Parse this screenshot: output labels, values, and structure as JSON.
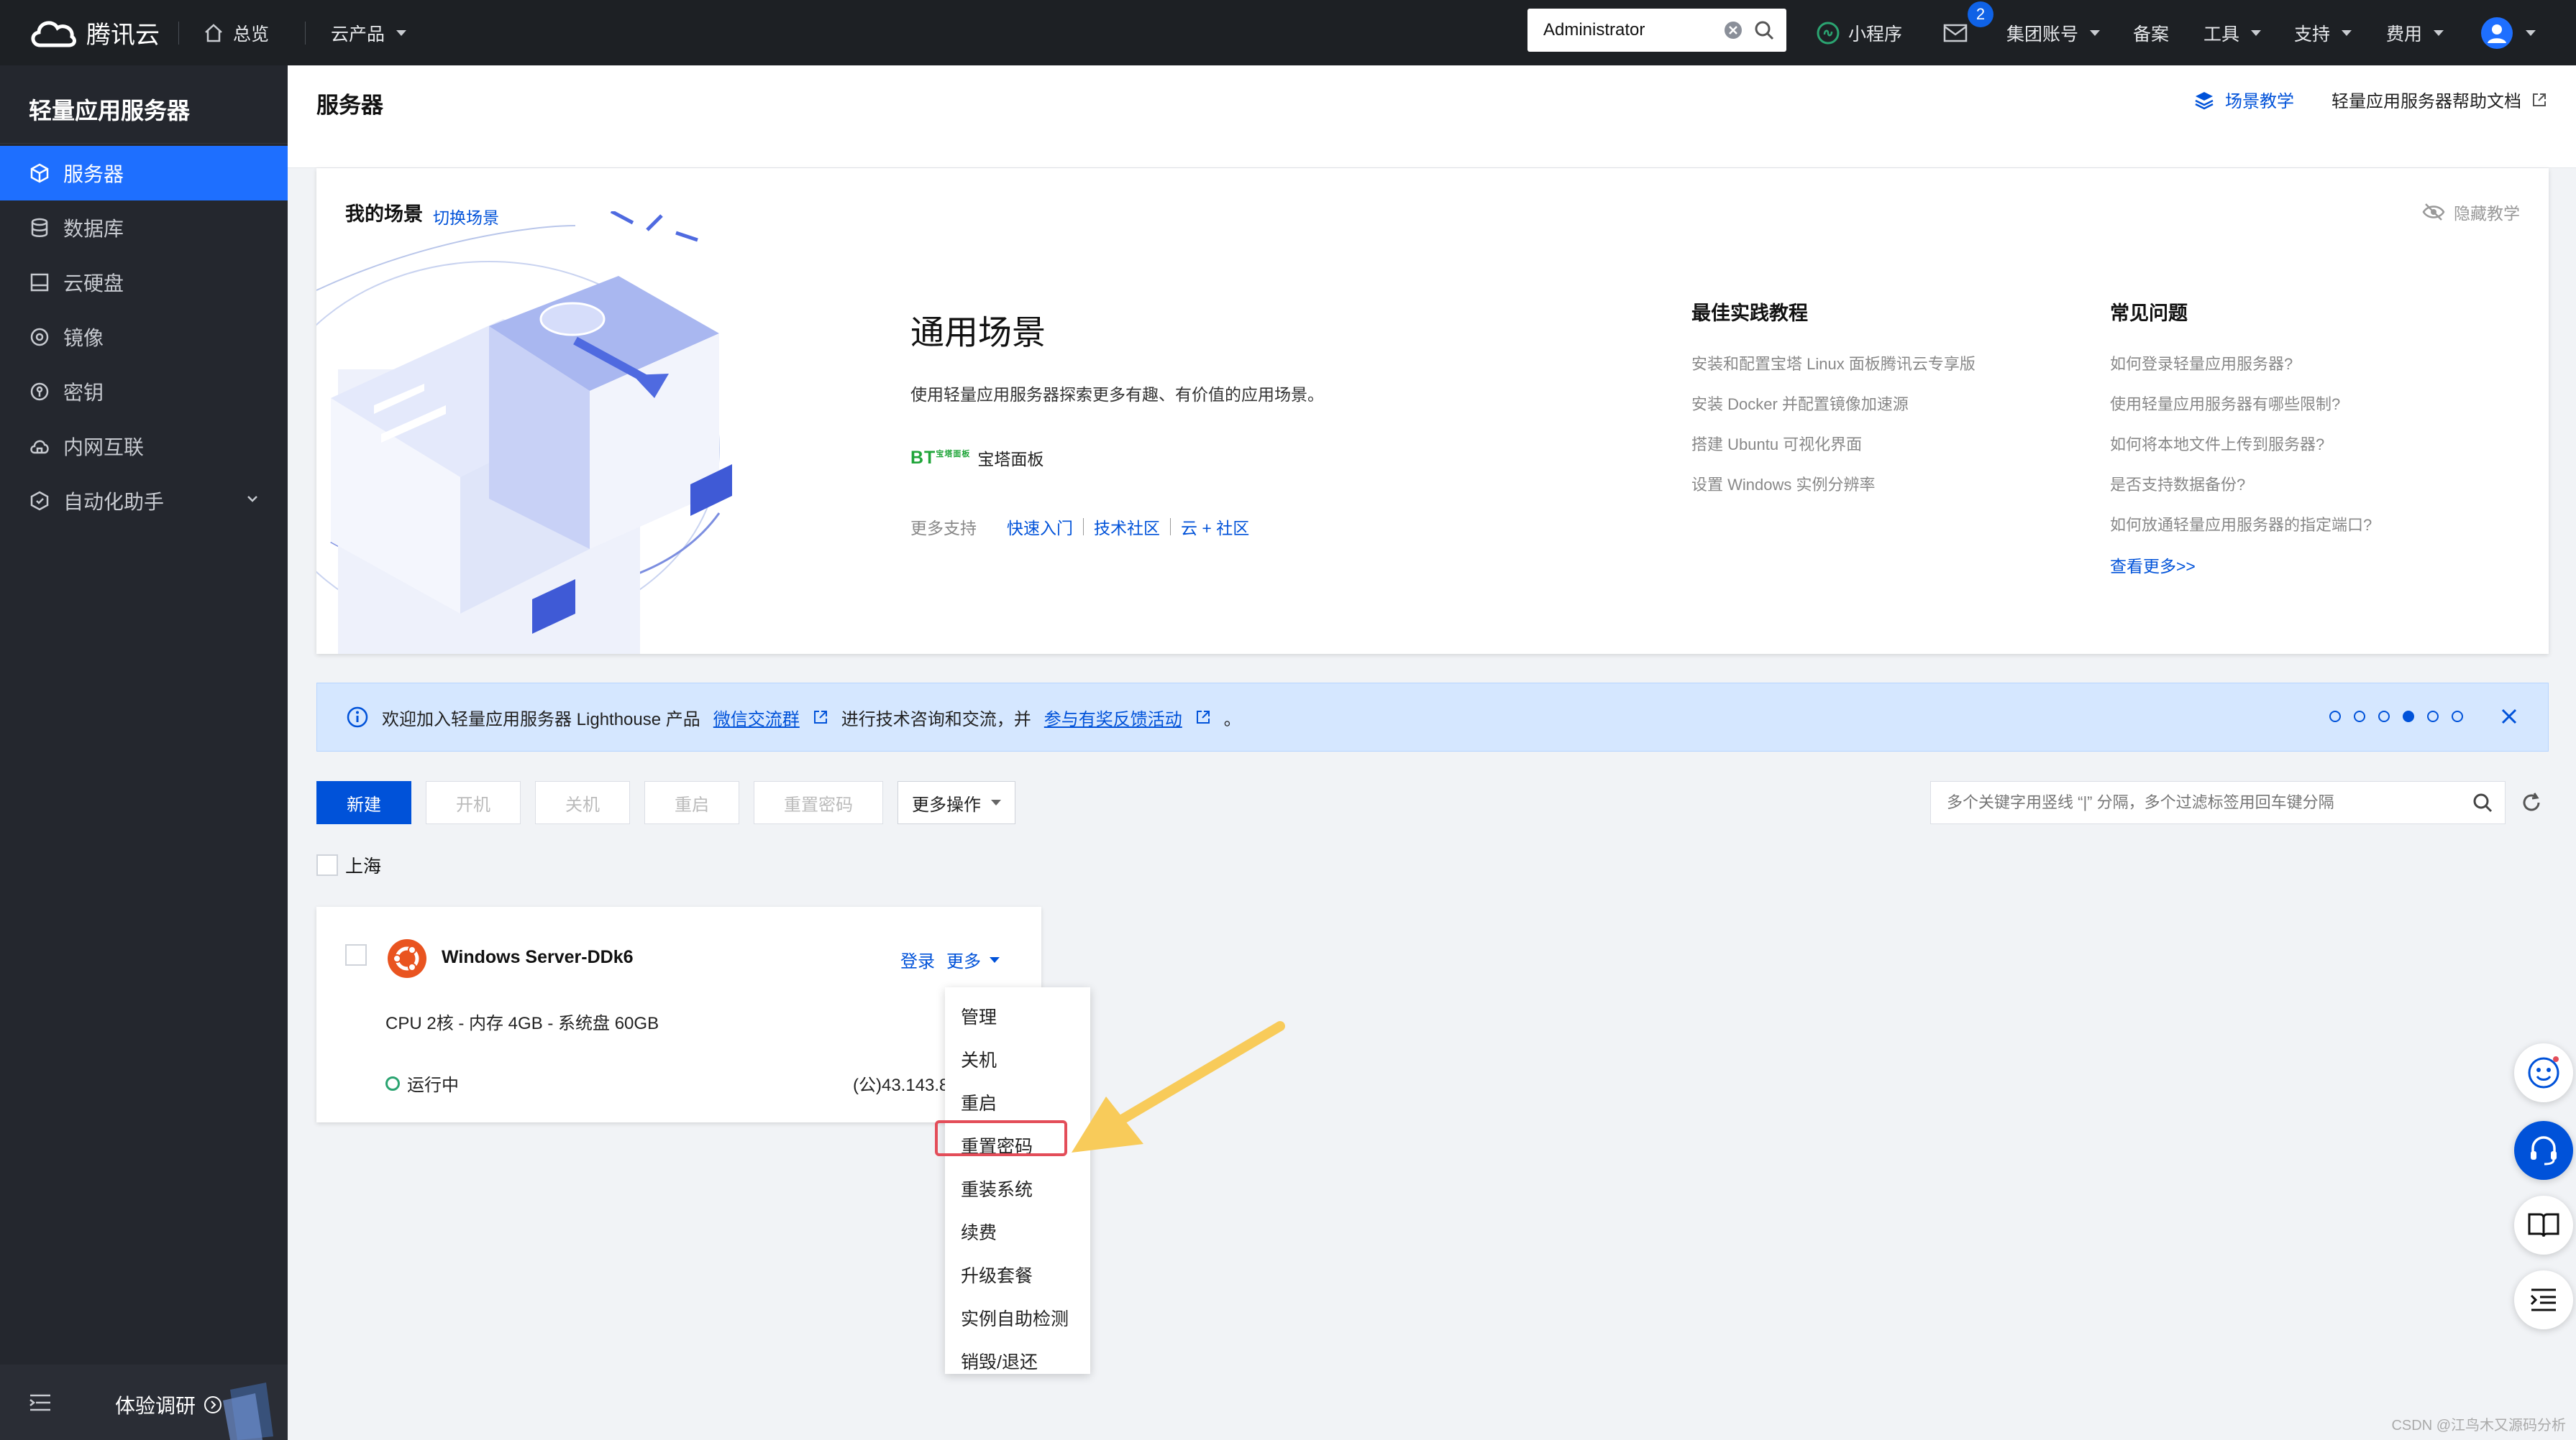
{
  "topbar": {
    "brand": "腾讯云",
    "overview": "总览",
    "products": "云产品",
    "search_value": "Administrator",
    "miniprogram": "小程序",
    "mail_badge": "2",
    "group_account": "集团账号",
    "filing": "备案",
    "tools": "工具",
    "support": "支持",
    "billing": "费用"
  },
  "sidebar": {
    "title": "轻量应用服务器",
    "items": [
      {
        "label": "服务器",
        "icon": "cube-icon",
        "active": true
      },
      {
        "label": "数据库",
        "icon": "database-icon"
      },
      {
        "label": "云硬盘",
        "icon": "disk-icon"
      },
      {
        "label": "镜像",
        "icon": "image-disc-icon"
      },
      {
        "label": "密钥",
        "icon": "key-icon"
      },
      {
        "label": "内网互联",
        "icon": "network-icon"
      },
      {
        "label": "自动化助手",
        "icon": "automation-icon"
      }
    ],
    "feedback": "体验调研"
  },
  "page": {
    "title": "服务器",
    "scene_tutorial": "场景教学",
    "help_doc": "轻量应用服务器帮助文档"
  },
  "scene": {
    "my_scene": "我的场景",
    "switch_scene": "切换场景",
    "hide_tutorial": "隐藏教学",
    "heading": "通用场景",
    "description": "使用轻量应用服务器探索更多有趣、有价值的应用场景。",
    "bt_logo": "BT",
    "bt_logo_sub": "宝塔面板",
    "bt_label": "宝塔面板",
    "more_support": "更多支持",
    "quick_start": "快速入门",
    "tech_community": "技术社区",
    "cloud_community": "云 + 社区",
    "best_practices": {
      "title": "最佳实践教程",
      "items": [
        "安装和配置宝塔 Linux 面板腾讯云专享版",
        "安装 Docker 并配置镜像加速源",
        "搭建 Ubuntu 可视化界面",
        "设置 Windows 实例分辨率"
      ]
    },
    "faq": {
      "title": "常见问题",
      "items": [
        "如何登录轻量应用服务器?",
        "使用轻量应用服务器有哪些限制?",
        "如何将本地文件上传到服务器?",
        "是否支持数据备份?",
        "如何放通轻量应用服务器的指定端口?"
      ],
      "more": "查看更多>>"
    }
  },
  "notice": {
    "text_1": "欢迎加入轻量应用服务器 Lighthouse 产品",
    "link_1": "微信交流群",
    "text_2": "进行技术咨询和交流，并",
    "link_2": "参与有奖反馈活动",
    "text_3": "。",
    "dots_total": 6,
    "dots_active": 4
  },
  "toolbar": {
    "create": "新建",
    "start": "开机",
    "shutdown": "关机",
    "restart": "重启",
    "reset_password": "重置密码",
    "more_actions": "更多操作",
    "filter_placeholder": "多个关键字用竖线 “|” 分隔，多个过滤标签用回车键分隔"
  },
  "region": "上海",
  "instance": {
    "name": "Windows Server-DDk6",
    "login": "登录",
    "more": "更多",
    "spec": "CPU 2核 - 内存 4GB - 系统盘 60GB",
    "status": "运行中",
    "ip": "(公)43.143.8"
  },
  "more_menu": [
    "管理",
    "关机",
    "重启",
    "重置密码",
    "重装系统",
    "续费",
    "升级套餐",
    "实例自助检测",
    "销毁/退还"
  ],
  "watermark": "CSDN @江鸟木又源码分析",
  "colors": {
    "primary": "#0052d9",
    "sidebar_active": "#1e6fff",
    "highlight": "#e34d59",
    "arrow": "#f8cb5a",
    "running": "#2ba471"
  }
}
